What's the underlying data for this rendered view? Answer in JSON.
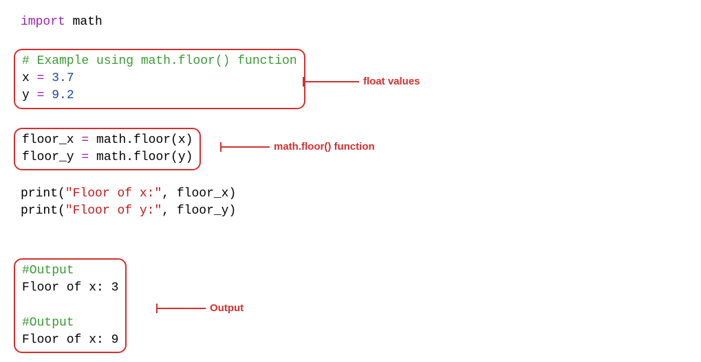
{
  "line_import": {
    "kw": "import",
    "mod": " math"
  },
  "box1": {
    "comment": "# Example using math.floor() function",
    "l2a": "x ",
    "l2b": "=",
    "l2c": " 3.7",
    "l3a": "y ",
    "l3b": "=",
    "l3c": " 9.2"
  },
  "box2": {
    "l1a": "floor_x ",
    "l1b": "=",
    "l1c": " math.floor(x)",
    "l2a": "floor_y ",
    "l2b": "=",
    "l2c": " math.floor(y)"
  },
  "print": {
    "l1a": "print",
    "l1b": "(",
    "l1c": "\"Floor of x:\"",
    "l1d": ", floor_x)",
    "l2a": "print",
    "l2b": "(",
    "l2c": "\"Floor of y:\"",
    "l2d": ", floor_y)"
  },
  "box3": {
    "c1": "#Output",
    "o1": "Floor of x: 3",
    "blank": " ",
    "c2": "#Output",
    "o2": "Floor of x: 9"
  },
  "annotations": {
    "a1": "float values",
    "a2": "math.floor() function",
    "a3": "Output"
  }
}
